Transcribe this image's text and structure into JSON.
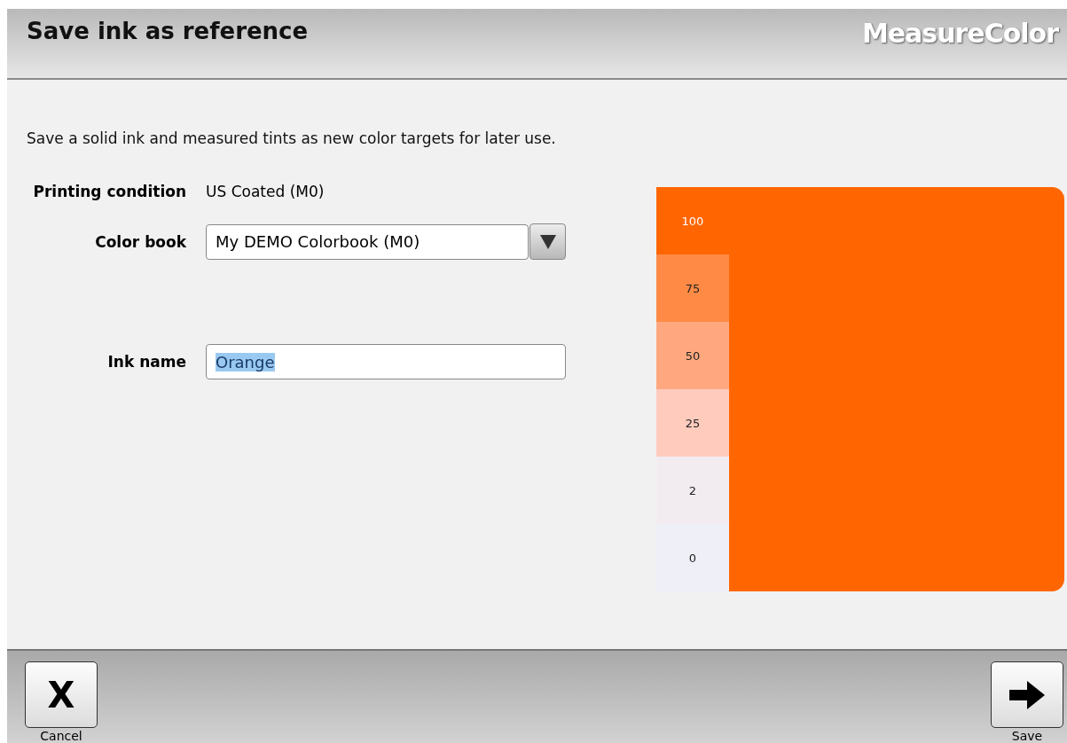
{
  "header": {
    "title": "Save ink as reference",
    "brand": "MeasureColor"
  },
  "description": "Save a solid ink and measured tints as new color targets for later use.",
  "printing_condition": {
    "label": "Printing condition",
    "value": "US Coated (M0)"
  },
  "color_book": {
    "label": "Color book",
    "value": "My DEMO Colorbook (M0)"
  },
  "ink_name": {
    "label": "Ink name",
    "value": "Orange",
    "text_selected": true
  },
  "swatch": {
    "color": "#ff6602",
    "tints": [
      {
        "label": "100",
        "color": "#ff6602",
        "dark": true
      },
      {
        "label": "75",
        "color": "#ff8a45",
        "dark": false
      },
      {
        "label": "50",
        "color": "#ffa87f",
        "dark": false
      },
      {
        "label": "25",
        "color": "#ffcbbd",
        "dark": false
      },
      {
        "label": "2",
        "color": "#f2ecf1",
        "dark": false
      },
      {
        "label": "0",
        "color": "#efeff8",
        "dark": false
      }
    ]
  },
  "footer": {
    "cancel": {
      "icon": "X",
      "label": "Cancel"
    },
    "save": {
      "label": "Save"
    }
  }
}
